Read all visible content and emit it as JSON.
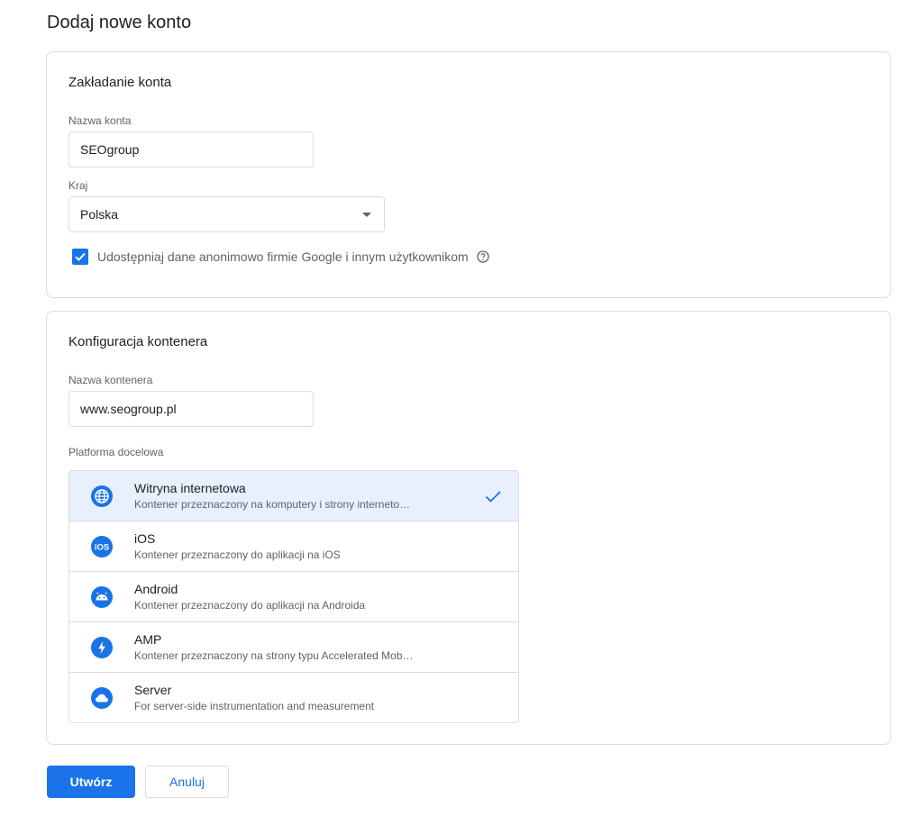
{
  "page": {
    "title": "Dodaj nowe konto"
  },
  "account": {
    "heading": "Zakładanie konta",
    "name_label": "Nazwa konta",
    "name_value": "SEOgroup",
    "country_label": "Kraj",
    "country_value": "Polska",
    "share_data_label": "Udostępniaj dane anonimowo firmie Google i innym użytkownikom",
    "share_data_checked": true
  },
  "container": {
    "heading": "Konfiguracja kontenera",
    "name_label": "Nazwa kontenera",
    "name_value": "www.seogroup.pl",
    "platform_label": "Platforma docelowa",
    "platforms": [
      {
        "title": "Witryna internetowa",
        "desc": "Kontener przeznaczony na komputery i strony interneto…",
        "icon": "globe-icon",
        "selected": true
      },
      {
        "title": "iOS",
        "desc": "Kontener przeznaczony do aplikacji na iOS",
        "icon": "ios-icon",
        "selected": false
      },
      {
        "title": "Android",
        "desc": "Kontener przeznaczony do aplikacji na Androida",
        "icon": "android-icon",
        "selected": false
      },
      {
        "title": "AMP",
        "desc": "Kontener przeznaczony na strony typu Accelerated Mob…",
        "icon": "amp-bolt-icon",
        "selected": false
      },
      {
        "title": "Server",
        "desc": "For server-side instrumentation and measurement",
        "icon": "cloud-icon",
        "selected": false
      }
    ]
  },
  "actions": {
    "create": "Utwórz",
    "cancel": "Anuluj"
  },
  "colors": {
    "accent": "#1a73e8",
    "selected_bg": "#e8f0fe",
    "border": "#dadce0"
  }
}
